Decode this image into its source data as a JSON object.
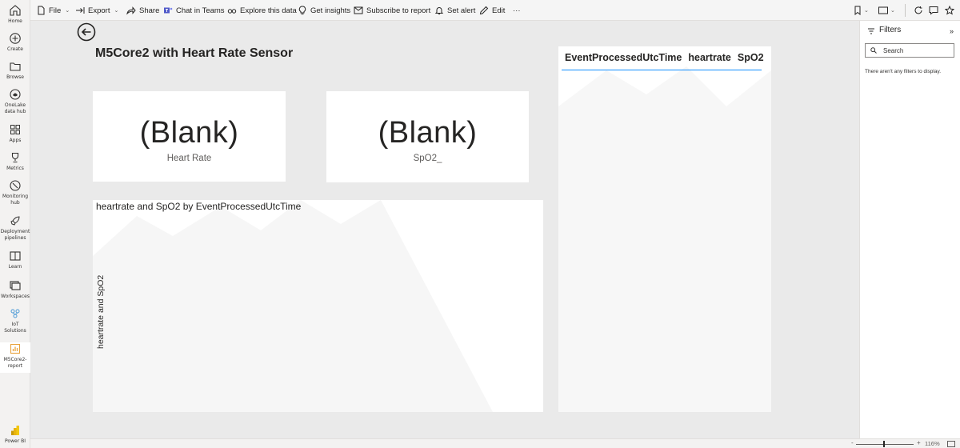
{
  "nav": {
    "items": [
      {
        "label": "Home",
        "icon": "home-icon"
      },
      {
        "label": "Create",
        "icon": "plus-circle-icon"
      },
      {
        "label": "Browse",
        "icon": "folder-icon"
      },
      {
        "label": "OneLake data hub",
        "icon": "onelake-icon"
      },
      {
        "label": "Apps",
        "icon": "apps-icon"
      },
      {
        "label": "Metrics",
        "icon": "trophy-icon"
      },
      {
        "label": "Monitoring hub",
        "icon": "monitor-icon"
      },
      {
        "label": "Deployment pipelines",
        "icon": "rocket-icon"
      },
      {
        "label": "Learn",
        "icon": "book-icon"
      },
      {
        "label": "Workspaces",
        "icon": "workspaces-icon"
      },
      {
        "label": "IoT Solutions",
        "icon": "people-icon"
      },
      {
        "label": "M5Core2-report",
        "icon": "report-icon"
      }
    ],
    "footer_label": "Power BI"
  },
  "toolbar": {
    "file": "File",
    "export": "Export",
    "share": "Share",
    "chat_in_teams": "Chat in Teams",
    "explore": "Explore this data",
    "insights": "Get insights",
    "subscribe": "Subscribe to report",
    "alert": "Set alert",
    "edit": "Edit",
    "more": "···"
  },
  "report": {
    "title": "M5Core2 with Heart Rate Sensor",
    "cards": [
      {
        "value": "(Blank)",
        "label": "Heart Rate"
      },
      {
        "value": "(Blank)",
        "label": "SpO2_"
      }
    ],
    "line_chart": {
      "title": "heartrate and SpO2 by EventProcessedUtcTime",
      "ylabel": "heartrate and SpO2"
    },
    "table": {
      "columns": [
        "EventProcessedUtcTime",
        "heartrate",
        "SpO2"
      ]
    }
  },
  "filters": {
    "title": "Filters",
    "search_placeholder": "Search",
    "empty_text": "There aren't any filters to display."
  },
  "status": {
    "zoom": "116%"
  },
  "colors": {
    "accent": "#118dff",
    "powerbi_yellow": "#f2c811"
  }
}
